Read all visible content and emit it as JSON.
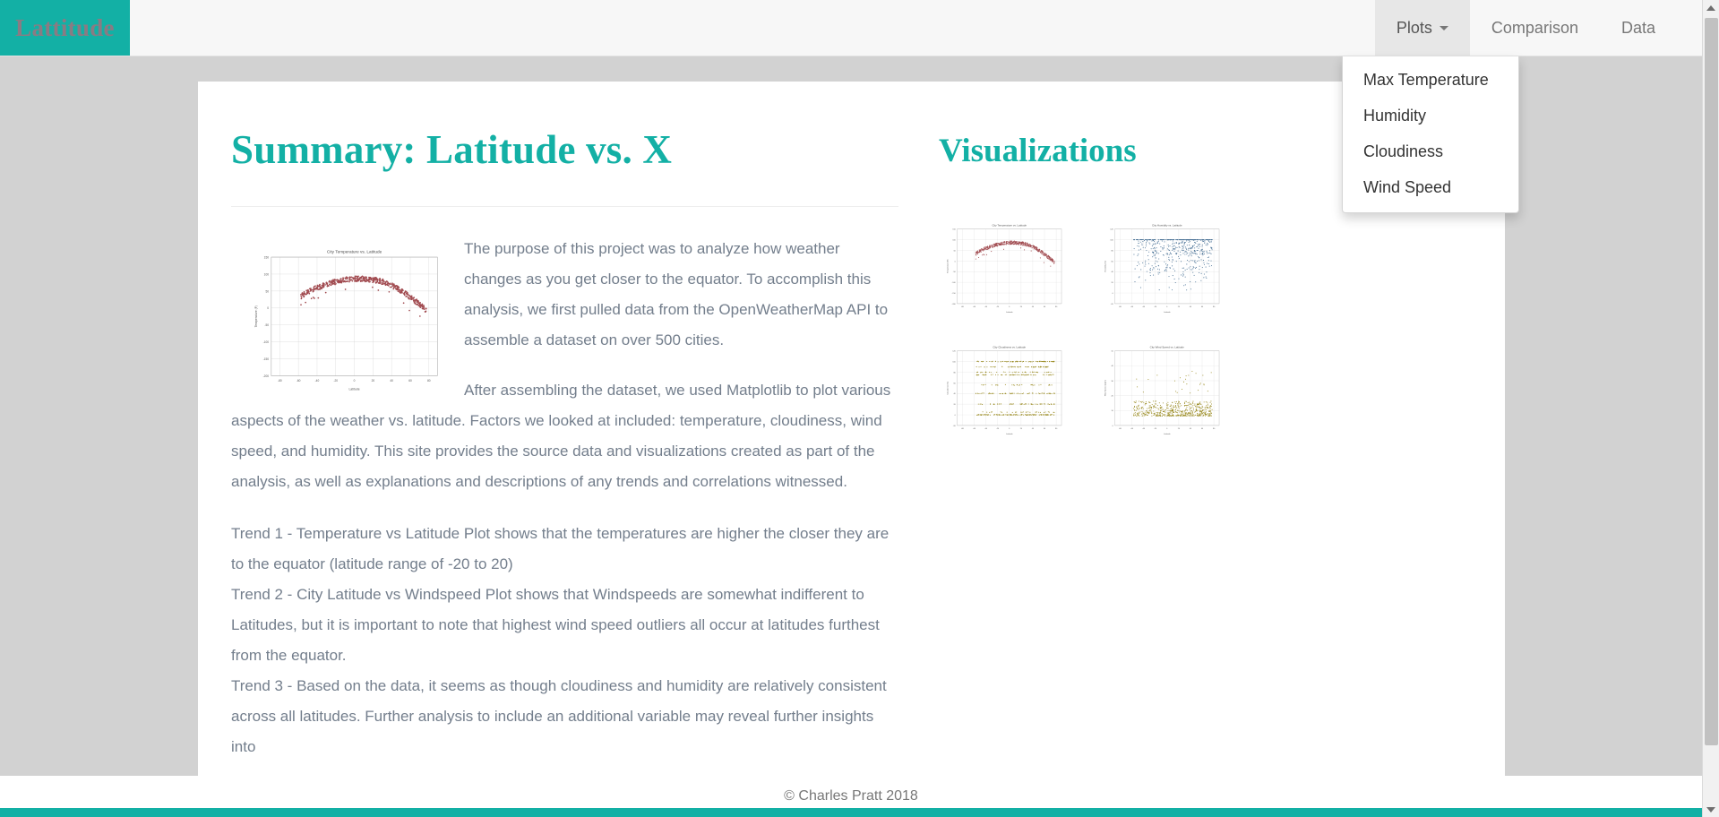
{
  "navbar": {
    "brand": "Lattitude",
    "items": [
      {
        "label": "Plots",
        "active": true,
        "has_caret": true
      },
      {
        "label": "Comparison",
        "active": false,
        "has_caret": false
      },
      {
        "label": "Data",
        "active": false,
        "has_caret": false
      }
    ],
    "dropdown": {
      "open": true,
      "items": [
        "Max Temperature",
        "Humidity",
        "Cloudiness",
        "Wind Speed"
      ]
    }
  },
  "main": {
    "page_title": "Summary: Latitude vs. X",
    "paragraph_1": "The purpose of this project was to analyze how weather changes as you get closer to the equator. To accomplish this analysis, we first pulled data from the OpenWeatherMap API to assemble a dataset on over 500 cities.",
    "paragraph_2": "After assembling the dataset, we used Matplotlib to plot various aspects of the weather vs. latitude. Factors we looked at included: temperature, cloudiness, wind speed, and humidity. This site provides the source data and visualizations created as part of the analysis, as well as explanations and descriptions of any trends and correlations witnessed.",
    "trend_1": "Trend 1 - Temperature vs Latitude Plot shows that the temperatures are higher the closer they are to the equator (latitude range of -20 to 20)",
    "trend_2": "Trend 2 - City Latitude vs Windspeed Plot shows that Windspeeds are somewhat indifferent to Latitudes, but it is important to note that highest wind speed outliers all occur at latitudes furthest from the equator.",
    "trend_3": "Trend 3 - Based on the data, it seems as though cloudiness and humidity are relatively consistent across all latitudes. Further analysis to include an additional variable may reveal further insights into"
  },
  "sidebar": {
    "viz_title": "Visualizations"
  },
  "footer": {
    "copyright": "© Charles Pratt 2018"
  },
  "colors": {
    "brand_teal": "#13b0a5",
    "body_text": "#737e8c",
    "temperature_dots": "#a14b50",
    "humidity_dots": "#4a7296",
    "cloudiness_dots": "#968619",
    "windspeed_dots": "#968619"
  },
  "chart_data": [
    {
      "id": "temperature",
      "type": "scatter",
      "title": "City Temperature vs. Latitude",
      "xlabel": "Latitude",
      "ylabel": "Temperature (F)",
      "xlim": [
        -90,
        90
      ],
      "ylim": [
        -200,
        150
      ],
      "xticks": [
        -80,
        -60,
        -40,
        -20,
        0,
        20,
        40,
        60,
        80
      ],
      "yticks": [
        -200,
        -150,
        -100,
        -50,
        0,
        50,
        100,
        150
      ],
      "grid": true,
      "marker_color": "#a14b50",
      "n_points": 520,
      "description": "Inverted-U shape peaking near latitude -10 to 10 at ~80F, falling to ~-30F at latitude 70.",
      "points": [
        [
          -54,
          47
        ],
        [
          -52,
          48
        ],
        [
          -50,
          50
        ],
        [
          -49,
          52
        ],
        [
          -47,
          55
        ],
        [
          -46,
          57
        ],
        [
          -45,
          60
        ],
        [
          -44,
          63
        ],
        [
          -43,
          61
        ],
        [
          -42,
          66
        ],
        [
          -41,
          68
        ],
        [
          -40,
          64
        ],
        [
          -39,
          70
        ],
        [
          -38,
          67
        ],
        [
          -37,
          72
        ],
        [
          -36,
          69
        ],
        [
          -35,
          74
        ],
        [
          -34,
          71
        ],
        [
          -33,
          76
        ],
        [
          -32,
          73
        ],
        [
          -31,
          78
        ],
        [
          -30,
          75
        ],
        [
          -29,
          80
        ],
        [
          -28,
          77
        ],
        [
          -27,
          82
        ],
        [
          -26,
          79
        ],
        [
          -25,
          95
        ],
        [
          -24,
          81
        ],
        [
          -23,
          83
        ],
        [
          -22,
          80
        ],
        [
          -21,
          85
        ],
        [
          -20,
          82
        ],
        [
          -19,
          84
        ],
        [
          -18,
          81
        ],
        [
          -17,
          86
        ],
        [
          -16,
          83
        ],
        [
          -15,
          85
        ],
        [
          -14,
          82
        ],
        [
          -13,
          87
        ],
        [
          -12,
          84
        ],
        [
          -11,
          86
        ],
        [
          -10,
          83
        ],
        [
          -9,
          88
        ],
        [
          -8,
          85
        ],
        [
          -7,
          87
        ],
        [
          -6,
          84
        ],
        [
          -5,
          86
        ],
        [
          -4,
          83
        ],
        [
          -3,
          88
        ],
        [
          -2,
          85
        ],
        [
          -1,
          87
        ],
        [
          0,
          84
        ],
        [
          1,
          86
        ],
        [
          2,
          83
        ],
        [
          3,
          88
        ],
        [
          4,
          85
        ],
        [
          5,
          87
        ],
        [
          6,
          84
        ],
        [
          7,
          89
        ],
        [
          8,
          86
        ],
        [
          9,
          88
        ],
        [
          10,
          85
        ],
        [
          11,
          87
        ],
        [
          12,
          84
        ],
        [
          13,
          86
        ],
        [
          14,
          83
        ],
        [
          15,
          85
        ],
        [
          16,
          82
        ],
        [
          17,
          84
        ],
        [
          18,
          81
        ],
        [
          19,
          83
        ],
        [
          20,
          78
        ],
        [
          22,
          76
        ],
        [
          24,
          74
        ],
        [
          26,
          70
        ],
        [
          28,
          68
        ],
        [
          30,
          64
        ],
        [
          32,
          60
        ],
        [
          34,
          57
        ],
        [
          36,
          53
        ],
        [
          38,
          50
        ],
        [
          40,
          46
        ],
        [
          42,
          42
        ],
        [
          44,
          38
        ],
        [
          46,
          34
        ],
        [
          48,
          30
        ],
        [
          50,
          27
        ],
        [
          52,
          23
        ],
        [
          54,
          19
        ],
        [
          56,
          16
        ],
        [
          58,
          12
        ],
        [
          60,
          9
        ],
        [
          62,
          5
        ],
        [
          64,
          2
        ],
        [
          66,
          -2
        ],
        [
          68,
          -8
        ],
        [
          70,
          -14
        ],
        [
          72,
          -22
        ],
        [
          74,
          -30
        ],
        [
          78,
          14
        ]
      ]
    },
    {
      "id": "humidity",
      "type": "scatter",
      "title": "City Humidity vs. Latitude",
      "xlabel": "Latitude",
      "ylabel": "Humidity (%)",
      "xlim": [
        -90,
        90
      ],
      "ylim": [
        -20,
        120
      ],
      "xticks": [
        -80,
        -60,
        -40,
        -20,
        0,
        20,
        40,
        60,
        80
      ],
      "yticks": [
        -20,
        0,
        20,
        40,
        60,
        80,
        100,
        120
      ],
      "grid": true,
      "marker_color": "#4a7296",
      "n_points": 520,
      "description": "Humidity spread across all latitudes with a dense saturated band at 100% and scattered points from 5% to 100%."
    },
    {
      "id": "cloudiness",
      "type": "scatter",
      "title": "City Cloudiness vs. Latitude",
      "xlabel": "Latitude",
      "ylabel": "Cloudiness (%)",
      "xlim": [
        -90,
        90
      ],
      "ylim": [
        -20,
        120
      ],
      "xticks": [
        -80,
        -60,
        -40,
        -20,
        0,
        20,
        40,
        60,
        80
      ],
      "yticks": [
        -20,
        0,
        20,
        40,
        60,
        80,
        100,
        120
      ],
      "grid": true,
      "marker_color": "#968619",
      "n_points": 520,
      "description": "Cloudiness values fall into horizontal bands at 0, 20, 40, 75, 90 and 100 percent across all latitudes."
    },
    {
      "id": "windspeed",
      "type": "scatter",
      "title": "City Wind Speed vs. Latitude",
      "xlabel": "Latitude",
      "ylabel": "Wind Speed (mph)",
      "xlim": [
        -90,
        90
      ],
      "ylim": [
        -5,
        50
      ],
      "xticks": [
        -80,
        -60,
        -40,
        -20,
        0,
        20,
        40,
        60,
        80
      ],
      "yticks": [
        0,
        10,
        20,
        30,
        40,
        50
      ],
      "grid": true,
      "marker_color": "#968619",
      "n_points": 520,
      "description": "Most wind speeds cluster between 2 and 12 mph at all latitudes, with high outliers up to 35 mph at extreme latitudes."
    }
  ]
}
